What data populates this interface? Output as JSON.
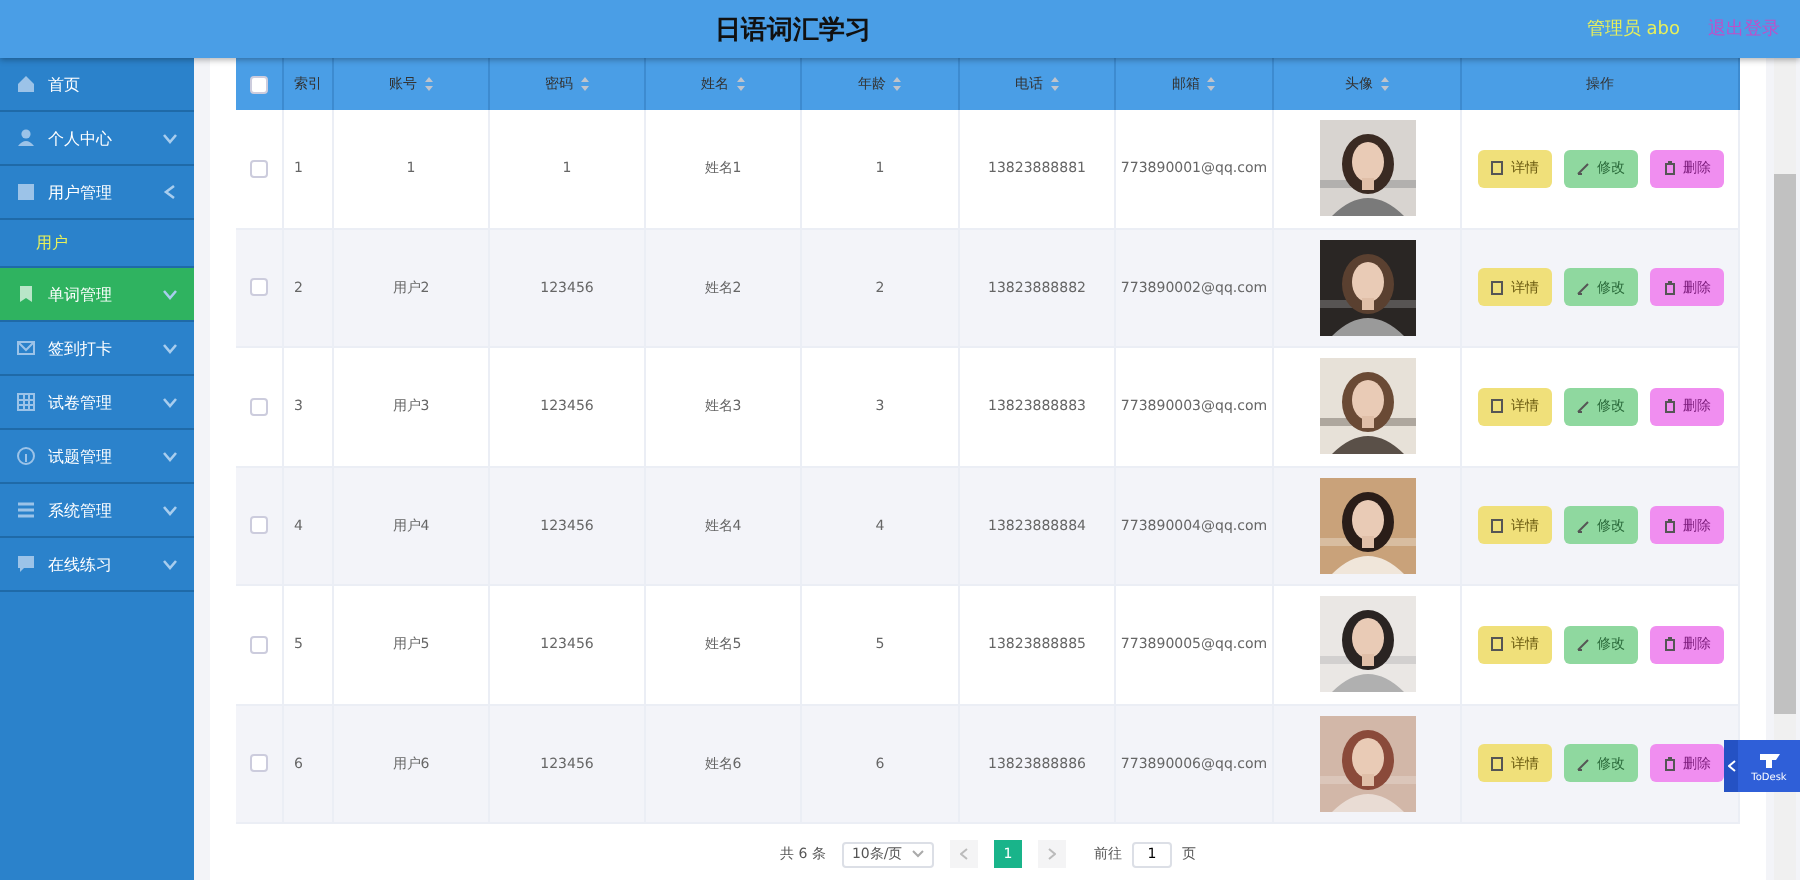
{
  "header": {
    "title": "日语词汇学习",
    "user": "管理员 abo",
    "logout": "退出登录"
  },
  "sidebar": {
    "items": [
      {
        "label": "首页",
        "expandable": false,
        "highlighted": false
      },
      {
        "label": "个人中心",
        "expandable": true,
        "expanded": false,
        "highlighted": false
      },
      {
        "label": "用户管理",
        "expandable": true,
        "expanded": true,
        "highlighted": false,
        "children": [
          {
            "label": "用户",
            "selected": true
          }
        ]
      },
      {
        "label": "单词管理",
        "expandable": true,
        "expanded": false,
        "highlighted": true
      },
      {
        "label": "签到打卡",
        "expandable": true,
        "expanded": false,
        "highlighted": false
      },
      {
        "label": "试卷管理",
        "expandable": true,
        "expanded": false,
        "highlighted": false
      },
      {
        "label": "试题管理",
        "expandable": true,
        "expanded": false,
        "highlighted": false
      },
      {
        "label": "系统管理",
        "expandable": true,
        "expanded": false,
        "highlighted": false
      },
      {
        "label": "在线练习",
        "expandable": true,
        "expanded": false,
        "highlighted": false
      }
    ]
  },
  "table": {
    "all_checked": false,
    "columns": [
      {
        "label": "索引",
        "sortable": false
      },
      {
        "label": "账号",
        "sortable": true
      },
      {
        "label": "密码",
        "sortable": true
      },
      {
        "label": "姓名",
        "sortable": true
      },
      {
        "label": "年龄",
        "sortable": true
      },
      {
        "label": "电话",
        "sortable": true
      },
      {
        "label": "邮箱",
        "sortable": true
      },
      {
        "label": "头像",
        "sortable": true
      },
      {
        "label": "操作",
        "sortable": false
      }
    ],
    "rows": [
      {
        "checked": false,
        "cells": [
          "1",
          "1",
          "1",
          "姓名1",
          "1",
          "13823888881",
          "773890001@qq.com"
        ],
        "actions": [
          "详情",
          "修改",
          "删除"
        ]
      },
      {
        "checked": false,
        "cells": [
          "2",
          "用户2",
          "123456",
          "姓名2",
          "2",
          "13823888882",
          "773890002@qq.com"
        ],
        "actions": [
          "详情",
          "修改",
          "删除"
        ]
      },
      {
        "checked": false,
        "cells": [
          "3",
          "用户3",
          "123456",
          "姓名3",
          "3",
          "13823888883",
          "773890003@qq.com"
        ],
        "actions": [
          "详情",
          "修改",
          "删除"
        ]
      },
      {
        "checked": false,
        "cells": [
          "4",
          "用户4",
          "123456",
          "姓名4",
          "4",
          "13823888884",
          "773890004@qq.com"
        ],
        "actions": [
          "详情",
          "修改",
          "删除"
        ]
      },
      {
        "checked": false,
        "cells": [
          "5",
          "用户5",
          "123456",
          "姓名5",
          "5",
          "13823888885",
          "773890005@qq.com"
        ],
        "actions": [
          "详情",
          "修改",
          "删除"
        ]
      },
      {
        "checked": false,
        "cells": [
          "6",
          "用户6",
          "123456",
          "姓名6",
          "6",
          "13823888886",
          "773890006@qq.com"
        ],
        "actions": [
          "详情",
          "修改",
          "删除"
        ]
      }
    ]
  },
  "pagination": {
    "total": "共 6 条",
    "page_size": "10条/页",
    "pages": [
      {
        "label": "1",
        "selected": true
      }
    ],
    "goto_label": "前往",
    "goto_value": "1",
    "goto_suffix": "页"
  },
  "floating_widget": {
    "label": "ToDesk"
  }
}
